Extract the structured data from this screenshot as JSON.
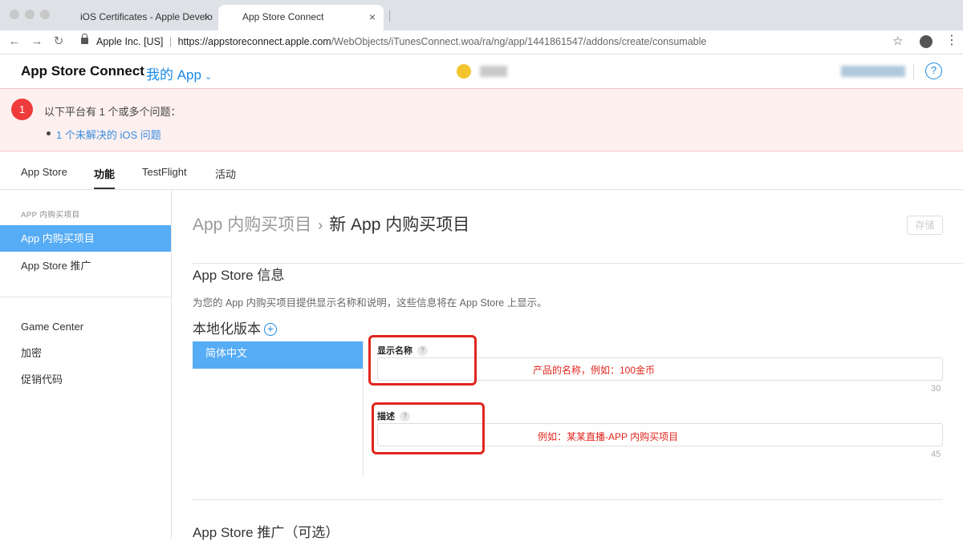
{
  "browser": {
    "tabs": [
      {
        "title": "iOS Certificates - Apple Develo",
        "close": "×"
      },
      {
        "title": "App Store Connect",
        "close": "×"
      }
    ],
    "back": "←",
    "forward": "→",
    "reload": "↻",
    "site_identity": "Apple Inc. [US]",
    "url_host": "https://appstoreconnect.apple.com",
    "url_path": "/WebObjects/iTunesConnect.woa/ra/ng/app/1441861547/addons/create/consumable",
    "star": "☆",
    "menu": "⋮"
  },
  "header": {
    "brand": "App Store Connect",
    "my_apps": "我的 App",
    "chevron": "⌄",
    "help": "?"
  },
  "alert": {
    "count": "1",
    "title": "以下平台有 1 个或多个问题：",
    "issue_link": "1 个未解决的 iOS 问题"
  },
  "section_tabs": [
    "App Store",
    "功能",
    "TestFlight",
    "活动"
  ],
  "sidebar": {
    "heading": "APP 内购买项目",
    "items": [
      "App 内购买项目",
      "App Store 推广",
      "Game Center",
      "加密",
      "促销代码"
    ]
  },
  "main": {
    "breadcrumb_parent": "App 内购买项目",
    "breadcrumb_sep": "›",
    "breadcrumb_current": "新 App 内购买项目",
    "save": "存储",
    "section_title": "App Store 信息",
    "section_desc": "为您的 App 内购买项目提供显示名称和说明，这些信息将在 App Store 上显示。",
    "localization_title": "本地化版本",
    "add_icon": "+",
    "language": "简体中文",
    "fields": [
      {
        "label": "显示名称",
        "help": "?",
        "hint": "产品的名称，例如：100金币",
        "counter": "30"
      },
      {
        "label": "描述",
        "help": "?",
        "hint": "例如：某某直播-APP 内购买项目",
        "counter": "45"
      }
    ],
    "promo_title": "App Store 推广（可选）"
  },
  "colors": {
    "accent": "#1a8ae5",
    "sidebar_active": "#56acf5",
    "alert_bg": "#fdf0ef",
    "alert_badge": "#ef3b3b",
    "annotation_red": "#e0261e"
  }
}
